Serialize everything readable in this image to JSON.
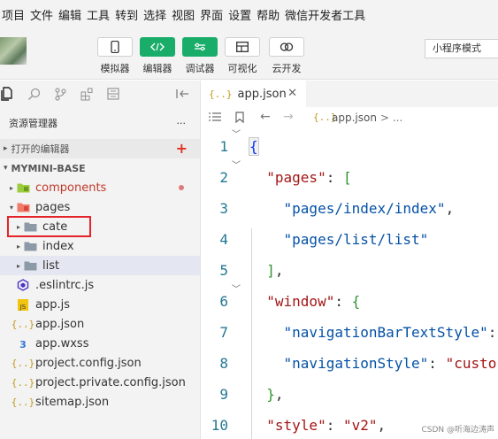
{
  "menu": [
    "项目",
    "文件",
    "编辑",
    "工具",
    "转到",
    "选择",
    "视图",
    "界面",
    "设置",
    "帮助",
    "微信开发者工具"
  ],
  "toolbar": {
    "tools": [
      {
        "label": "模拟器",
        "icon": "phone-icon"
      },
      {
        "label": "编辑器",
        "icon": "code-icon"
      },
      {
        "label": "调试器",
        "icon": "debug-icon"
      },
      {
        "label": "可视化",
        "icon": "layout-icon"
      },
      {
        "label": "云开发",
        "icon": "cloud-icon"
      }
    ],
    "mode": "小程序模式"
  },
  "sidebar": {
    "title": "资源管理器",
    "more": "···",
    "open_editors": "打开的编辑器",
    "open_editors_add": "+",
    "project": "MYMINI-BASE",
    "tree": [
      {
        "name": "components",
        "icon": "folder-components-icon",
        "depth": 0,
        "twisty": "▸"
      },
      {
        "name": "pages",
        "icon": "folder-pages-icon",
        "depth": 0,
        "twisty": "▾"
      },
      {
        "name": "cate",
        "icon": "folder-icon",
        "depth": 1,
        "twisty": "▸"
      },
      {
        "name": "index",
        "icon": "folder-icon",
        "depth": 1,
        "twisty": "▸"
      },
      {
        "name": "list",
        "icon": "folder-icon",
        "depth": 1,
        "twisty": "▸"
      },
      {
        "name": ".eslintrc.js",
        "icon": "eslint-icon",
        "depth": 0,
        "twisty": ""
      },
      {
        "name": "app.js",
        "icon": "js-icon",
        "depth": 0,
        "twisty": ""
      },
      {
        "name": "app.json",
        "icon": "json-icon",
        "depth": 0,
        "twisty": ""
      },
      {
        "name": "app.wxss",
        "icon": "css-icon",
        "depth": 0,
        "twisty": ""
      },
      {
        "name": "project.config.json",
        "icon": "json-icon",
        "depth": 0,
        "twisty": ""
      },
      {
        "name": "project.private.config.json",
        "icon": "json-icon",
        "depth": 0,
        "twisty": ""
      },
      {
        "name": "sitemap.json",
        "icon": "json-icon",
        "depth": 0,
        "twisty": ""
      }
    ]
  },
  "editor": {
    "tab_label": "app.json",
    "tab_glyph": "{..}",
    "breadcrumb_file": "app.json",
    "breadcrumb_more": "> ...",
    "lines": [
      {
        "num": "1",
        "text": "{"
      },
      {
        "num": "2",
        "text": "  \"pages\": ["
      },
      {
        "num": "3",
        "text": "    \"pages/index/index\","
      },
      {
        "num": "4",
        "text": "    \"pages/list/list\""
      },
      {
        "num": "5",
        "text": "  ],"
      },
      {
        "num": "6",
        "text": "  \"window\": {"
      },
      {
        "num": "7",
        "text": "    \"navigationBarTextStyle\":"
      },
      {
        "num": "8",
        "text": "    \"navigationStyle\": \"custo"
      },
      {
        "num": "9",
        "text": "  },"
      },
      {
        "num": "10",
        "text": "  \"style\": \"v2\","
      }
    ]
  },
  "watermark": "CSDN @听海边涛声",
  "colors": {
    "accent_green": "#1aad6a",
    "highlight_red": "#e3242b"
  }
}
